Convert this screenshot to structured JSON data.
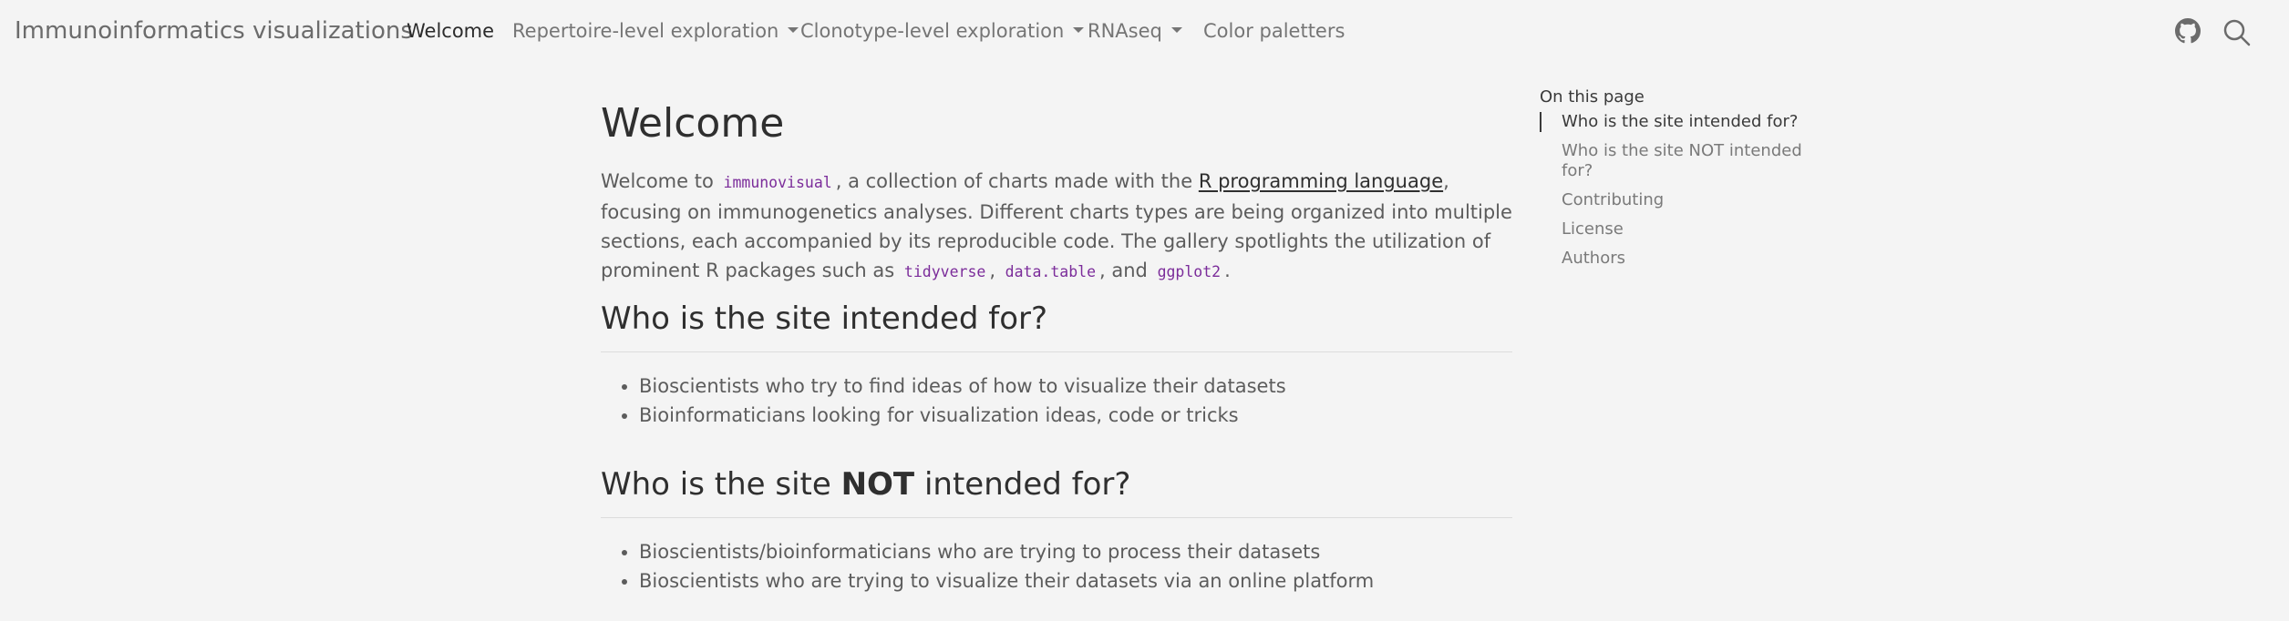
{
  "navbar": {
    "brand": "Immunoinformatics visualizations",
    "items": [
      {
        "label": "Welcome",
        "active": true,
        "dropdown": false
      },
      {
        "label": "Repertoire-level exploration",
        "dropdown": true
      },
      {
        "label": "Clonotype-level exploration",
        "dropdown": true
      },
      {
        "label": "RNAseq",
        "dropdown": true
      },
      {
        "label": "Color paletters",
        "dropdown": false
      }
    ],
    "icons": [
      "github-icon",
      "search-icon"
    ]
  },
  "main": {
    "title": "Welcome",
    "intro": {
      "t1": "Welcome to",
      "code1": "immunovisual",
      "t2": ", a collection of charts made with the",
      "link": "R programming language",
      "t3": ", focusing on immunogenetics analyses. Different charts types are being organized into multiple sections, each accompanied by its reproducible code. The gallery spotlights the utilization of prominent R packages such as",
      "code2": "tidyverse",
      "code3": "data.table",
      "t4": ", and",
      "code4": "ggplot2",
      "t5": "."
    },
    "section1": {
      "heading": "Who is the site intended for?",
      "items": [
        "Bioscientists who try to find ideas of how to visualize their datasets",
        "Bioinformaticians looking for visualization ideas, code or tricks"
      ]
    },
    "section2": {
      "heading_pre": "Who is the site",
      "heading_bold": "NOT",
      "heading_post": "intended for?",
      "items": [
        "Bioscientists/bioinformaticians who are trying to process their datasets",
        "Bioscientists who are trying to visualize their datasets via an online platform"
      ]
    }
  },
  "toc": {
    "title": "On this page",
    "items": [
      "Who is the site intended for?",
      "Who is the site NOT intended for?",
      "Contributing",
      "License",
      "Authors"
    ]
  }
}
